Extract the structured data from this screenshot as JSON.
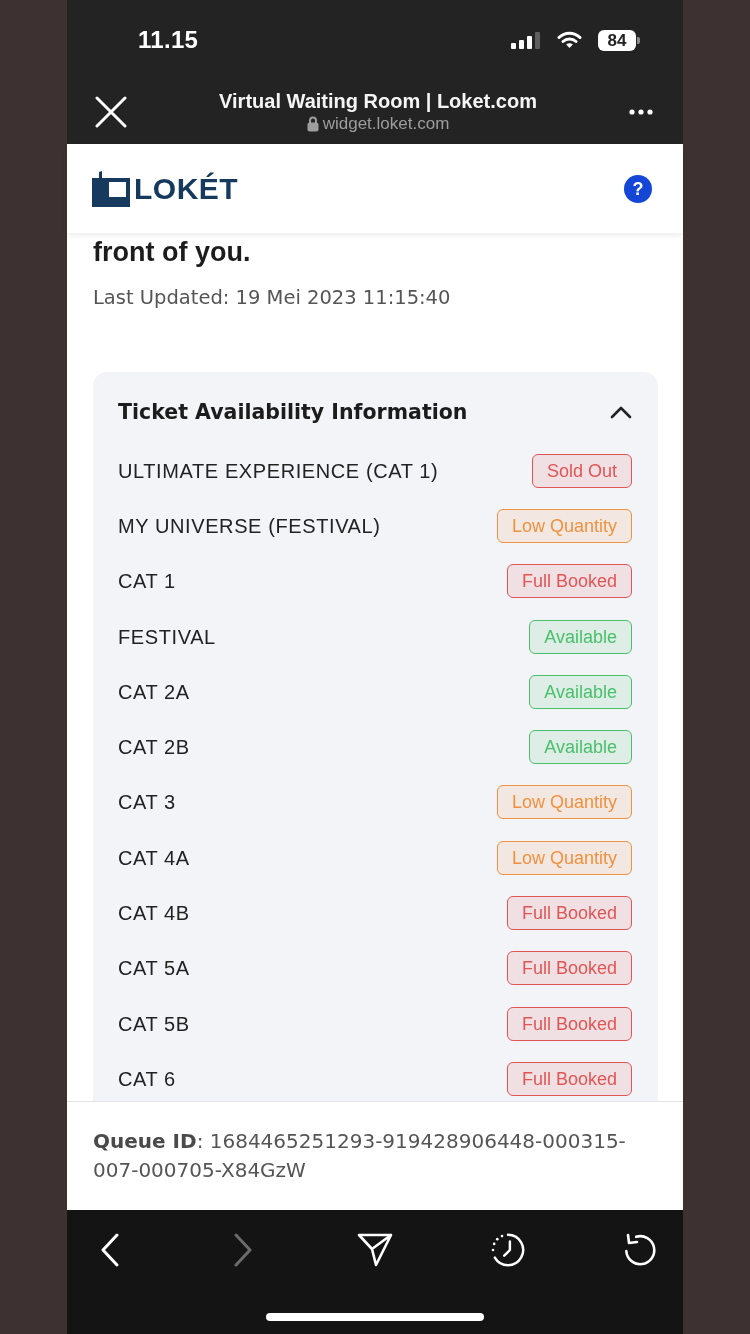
{
  "status_bar": {
    "time": "11.15",
    "battery": "84"
  },
  "browser_bar": {
    "title": "Virtual Waiting Room | Loket.com",
    "url": "widget.loket.com"
  },
  "site_header": {
    "logo": "LOKÉT",
    "help": "?"
  },
  "message": {
    "text": "front of you.",
    "last_updated": "Last Updated: 19 Mei 2023 11:15:40"
  },
  "availability": {
    "title": "Ticket Availability Information",
    "expanded": true,
    "rows": [
      {
        "name": "ULTIMATE EXPERIENCE (CAT 1)",
        "status": "Sold Out",
        "color": "#e25555"
      },
      {
        "name": "MY UNIVERSE (FESTIVAL)",
        "status": "Low Quantity",
        "color": "#f0913f"
      },
      {
        "name": "CAT 1",
        "status": "Full Booked",
        "color": "#e25555"
      },
      {
        "name": "FESTIVAL",
        "status": "Available",
        "color": "#49c06a"
      },
      {
        "name": "CAT 2A",
        "status": "Available",
        "color": "#49c06a"
      },
      {
        "name": "CAT 2B",
        "status": "Available",
        "color": "#49c06a"
      },
      {
        "name": "CAT 3",
        "status": "Low Quantity",
        "color": "#f0913f"
      },
      {
        "name": "CAT 4A",
        "status": "Low Quantity",
        "color": "#f0913f"
      },
      {
        "name": "CAT 4B",
        "status": "Full Booked",
        "color": "#e25555"
      },
      {
        "name": "CAT 5A",
        "status": "Full Booked",
        "color": "#e25555"
      },
      {
        "name": "CAT 5B",
        "status": "Full Booked",
        "color": "#e25555"
      },
      {
        "name": "CAT 6",
        "status": "Full Booked",
        "color": "#e25555"
      }
    ]
  },
  "footer": {
    "queue_id": "**Queue ID**: 1684465251293-919428906448-000315-007-000705-X84GzW"
  },
  "toolbar": [
    {
      "kind": "back",
      "disabled": false
    },
    {
      "kind": "forward",
      "disabled": true
    },
    {
      "kind": "share",
      "disabled": false
    },
    {
      "kind": "history",
      "disabled": false
    },
    {
      "kind": "reload",
      "disabled": false
    }
  ]
}
